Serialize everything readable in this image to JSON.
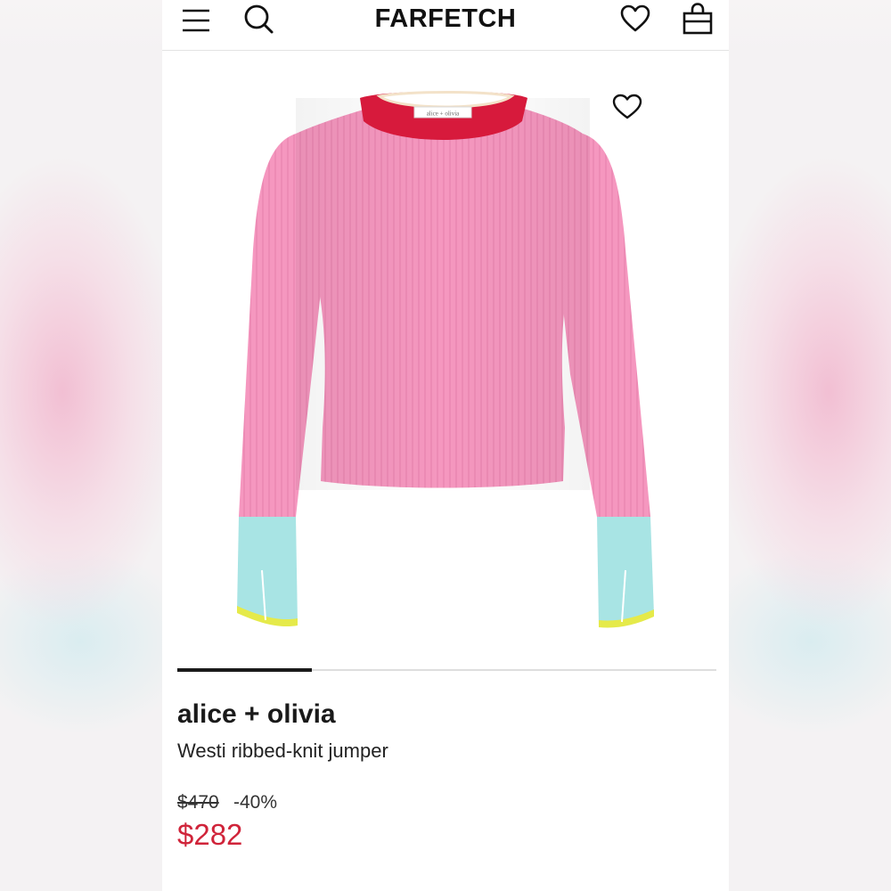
{
  "header": {
    "logo": "FARFETCH",
    "menu_icon": "hamburger-menu-icon",
    "search_icon": "search-icon",
    "wishlist_icon": "heart-icon",
    "bag_icon": "shopping-bag-icon"
  },
  "product": {
    "brand": "alice + olivia",
    "name": "Westi ribbed-knit jumper",
    "original_price": "$470",
    "discount": "-40%",
    "sale_price": "$282",
    "image_icon": "ribbed-knit-jumper-image",
    "wishlist_icon": "heart-outline-icon",
    "label_text": "alice + olivia"
  },
  "gallery": {
    "progress": 0.25
  },
  "colors": {
    "sale_price": "#d0243a",
    "sweater_body": "#f597bf",
    "collar": "#d71a3c",
    "cuffs": "#a8e4e4",
    "cuff_trim": "#e5ea4a"
  }
}
